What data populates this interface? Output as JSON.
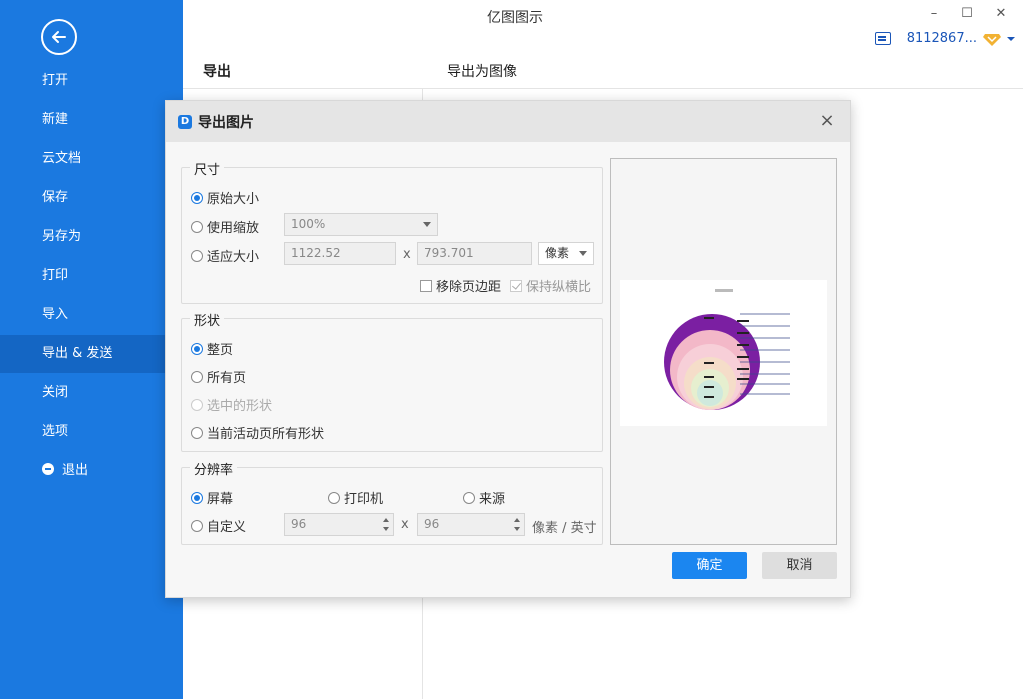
{
  "app": {
    "title": "亿图图示"
  },
  "window_controls": {
    "minimize": "–",
    "maximize": "☐",
    "close": "✕"
  },
  "user": {
    "id": "8112867...",
    "badge_color": "#f2b233"
  },
  "sidebar": {
    "accent": "#1b79e0",
    "items": [
      {
        "label": "打开"
      },
      {
        "label": "新建"
      },
      {
        "label": "云文档"
      },
      {
        "label": "保存"
      },
      {
        "label": "另存为"
      },
      {
        "label": "打印"
      },
      {
        "label": "导入"
      },
      {
        "label": "导出 & 发送"
      },
      {
        "label": "关闭"
      },
      {
        "label": "选项"
      },
      {
        "label": "退出"
      }
    ]
  },
  "main": {
    "col1_title": "导出",
    "col2_title": "导出为图像"
  },
  "dialog": {
    "title": "导出图片",
    "size_group": {
      "legend": "尺寸",
      "original": "原始大小",
      "use_zoom": "使用缩放",
      "zoom_value": "100%",
      "fit_size": "适应大小",
      "width": "1122.52",
      "times": "x",
      "height": "793.701",
      "unit": "像素",
      "remove_margin": "移除页边距",
      "keep_ratio": "保持纵横比"
    },
    "shape_group": {
      "legend": "形状",
      "whole_page": "整页",
      "all_pages": "所有页",
      "selected": "选中的形状",
      "active_page_all": "当前活动页所有形状"
    },
    "resolution_group": {
      "legend": "分辨率",
      "screen": "屏幕",
      "printer": "打印机",
      "source": "来源",
      "custom": "自定义",
      "dpi_x": "96",
      "times": "x",
      "dpi_y": "96",
      "unit": "像素 / 英寸"
    },
    "ok": "确定",
    "cancel": "取消"
  }
}
